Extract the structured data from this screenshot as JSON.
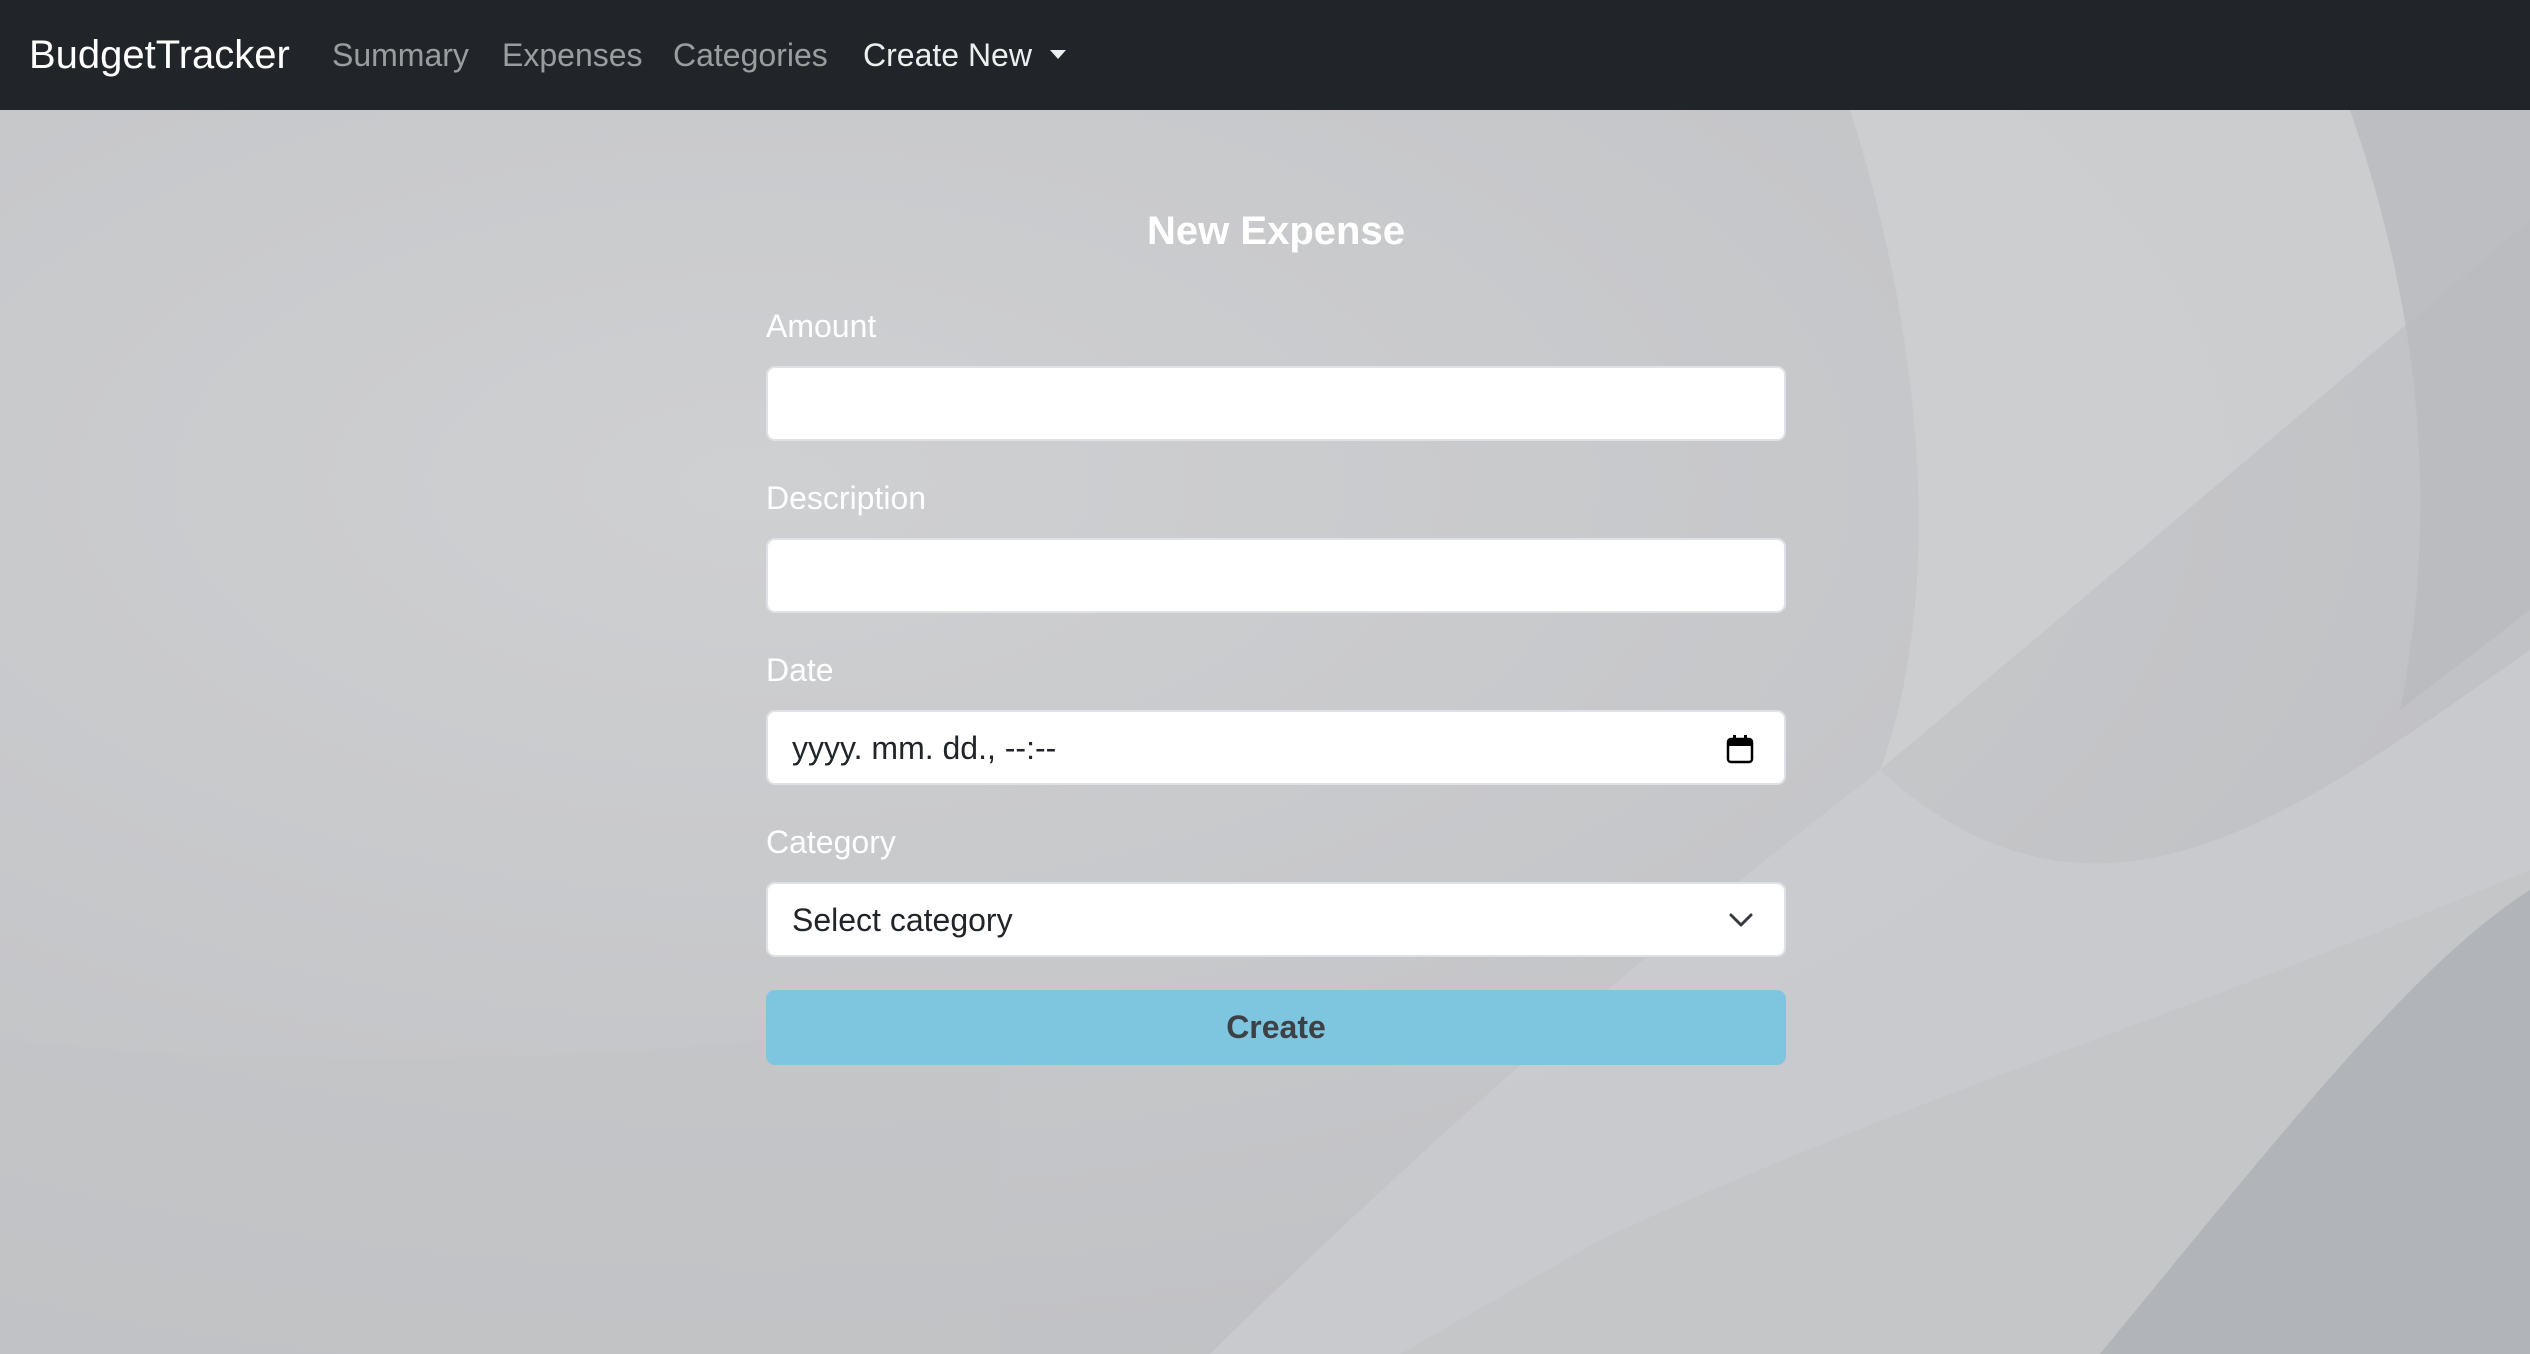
{
  "nav": {
    "brand": "BudgetTracker",
    "links": [
      "Summary",
      "Expenses",
      "Categories"
    ],
    "dropdown_label": "Create New"
  },
  "form": {
    "title": "New Expense",
    "amount_label": "Amount",
    "amount_value": "",
    "description_label": "Description",
    "description_value": "",
    "date_label": "Date",
    "date_value": "yyyy. mm. dd., --:--",
    "category_label": "Category",
    "category_value": "Select category",
    "submit_label": "Create"
  },
  "colors": {
    "navbar": "#212529",
    "primary_button": "#7ec6e0",
    "background": "#c6c7c9"
  },
  "icons": {
    "date": "calendar-icon",
    "category": "chevron-down-icon",
    "dropdown": "caret-down-icon"
  }
}
